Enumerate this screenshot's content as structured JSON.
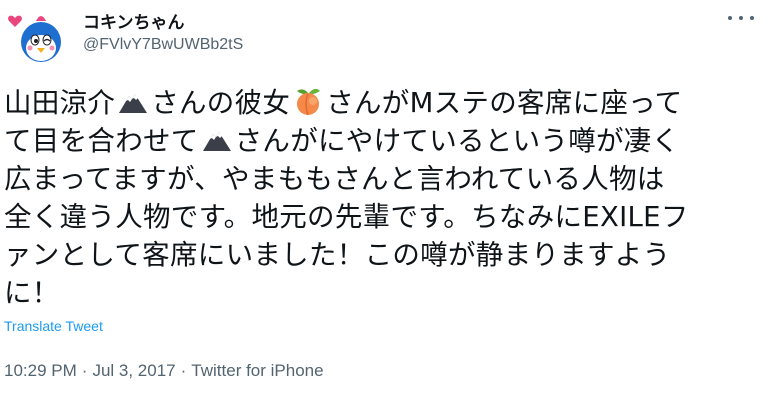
{
  "user": {
    "display_name": "コキンちゃん",
    "handle": "@FVlvY7BwUWBb2tS"
  },
  "tweet": {
    "lines": [
      [
        "山田涼介",
        "mountain-emoji",
        "さんの彼女",
        "peach-emoji",
        "さんがMステの客席に座って"
      ],
      [
        "て目を合わせて",
        "mountain-emoji",
        "さんがにやけているという噂が凄く"
      ],
      [
        "広まってますが、やまももさんと言われている人物は"
      ],
      [
        "全く違う人物です。地元の先輩です。ちなみにEXILEフ"
      ],
      [
        "ァンとして客席にいました！この噂が静まりますよう"
      ],
      [
        "に！"
      ]
    ],
    "translate_label": "Translate Tweet",
    "time": "10:29 PM",
    "date": "Jul 3, 2017",
    "source": "Twitter for iPhone",
    "separator": "·"
  },
  "colors": {
    "text": "#0f1419",
    "secondary": "#536471",
    "link": "#1d9bf0"
  }
}
